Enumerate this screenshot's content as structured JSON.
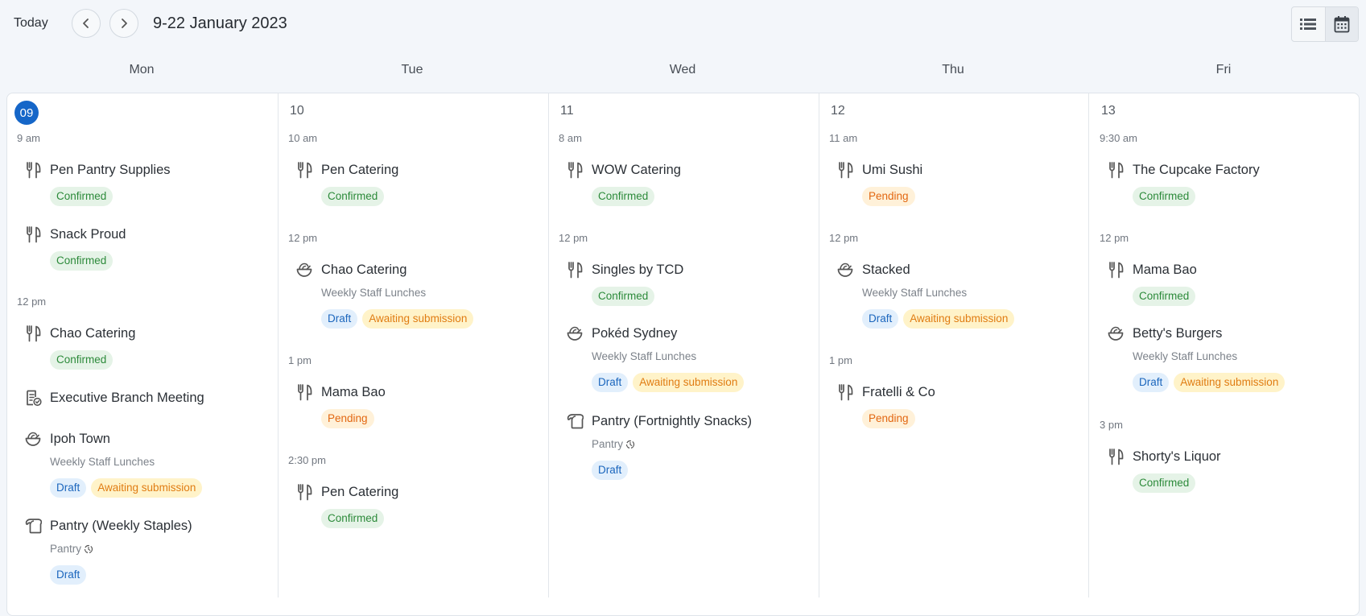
{
  "toolbar": {
    "today_label": "Today",
    "date_range": "9-22 January 2023",
    "prev_icon": "chevron-left-icon",
    "next_icon": "chevron-right-icon",
    "list_view_icon": "list-view-icon",
    "calendar_view_icon": "calendar-view-icon"
  },
  "days": [
    {
      "name": "Mon",
      "number": "09"
    },
    {
      "name": "Tue",
      "number": "10"
    },
    {
      "name": "Wed",
      "number": "11"
    },
    {
      "name": "Thu",
      "number": "12"
    },
    {
      "name": "Fri",
      "number": "13"
    }
  ],
  "mon": {
    "t1": "9 am",
    "e1": {
      "title": "Pen Pantry Supplies",
      "badge": "Confirmed"
    },
    "e2": {
      "title": "Snack Proud",
      "badge": "Confirmed"
    },
    "t2": "12 pm",
    "e3": {
      "title": "Chao Catering",
      "badge": "Confirmed"
    },
    "e4": {
      "title": "Executive Branch Meeting"
    },
    "e5": {
      "title": "Ipoh Town",
      "sub": "Weekly Staff Lunches",
      "badge1": "Draft",
      "badge2": "Awaiting submission"
    },
    "e6": {
      "title": "Pantry (Weekly Staples)",
      "sub": "Pantry",
      "badge": "Draft"
    }
  },
  "tue": {
    "t1": "10 am",
    "e1": {
      "title": "Pen Catering",
      "badge": "Confirmed"
    },
    "t2": "12 pm",
    "e2": {
      "title": "Chao Catering",
      "sub": "Weekly Staff Lunches",
      "badge1": "Draft",
      "badge2": "Awaiting submission"
    },
    "t3": "1 pm",
    "e3": {
      "title": "Mama Bao",
      "badge": "Pending"
    },
    "t4": "2:30 pm",
    "e4": {
      "title": "Pen Catering",
      "badge": "Confirmed"
    }
  },
  "wed": {
    "t1": "8 am",
    "e1": {
      "title": "WOW Catering",
      "badge": "Confirmed"
    },
    "t2": "12 pm",
    "e2": {
      "title": "Singles by TCD",
      "badge": "Confirmed"
    },
    "e3": {
      "title": "Pokéd Sydney",
      "sub": "Weekly Staff Lunches",
      "badge1": "Draft",
      "badge2": "Awaiting submission"
    },
    "e4": {
      "title": "Pantry (Fortnightly Snacks)",
      "sub": "Pantry",
      "badge": "Draft"
    }
  },
  "thu": {
    "t1": "11 am",
    "e1": {
      "title": "Umi Sushi",
      "badge": "Pending"
    },
    "t2": "12 pm",
    "e2": {
      "title": "Stacked",
      "sub": "Weekly Staff Lunches",
      "badge1": "Draft",
      "badge2": "Awaiting submission"
    },
    "t3": "1 pm",
    "e3": {
      "title": "Fratelli & Co",
      "badge": "Pending"
    }
  },
  "fri": {
    "t1": "9:30 am",
    "e1": {
      "title": "The Cupcake Factory",
      "badge": "Confirmed"
    },
    "t2": "12 pm",
    "e2": {
      "title": "Mama Bao",
      "badge": "Confirmed"
    },
    "e3": {
      "title": "Betty's Burgers",
      "sub": "Weekly Staff Lunches",
      "badge1": "Draft",
      "badge2": "Awaiting submission"
    },
    "t3": "3 pm",
    "e4": {
      "title": "Shorty's Liquor",
      "badge": "Confirmed"
    }
  },
  "colors": {
    "today_accent": "#1566c8",
    "confirmed": "#2c8a3a",
    "pending": "#e26711",
    "draft": "#1b66bd",
    "awaiting": "#e07c12"
  }
}
